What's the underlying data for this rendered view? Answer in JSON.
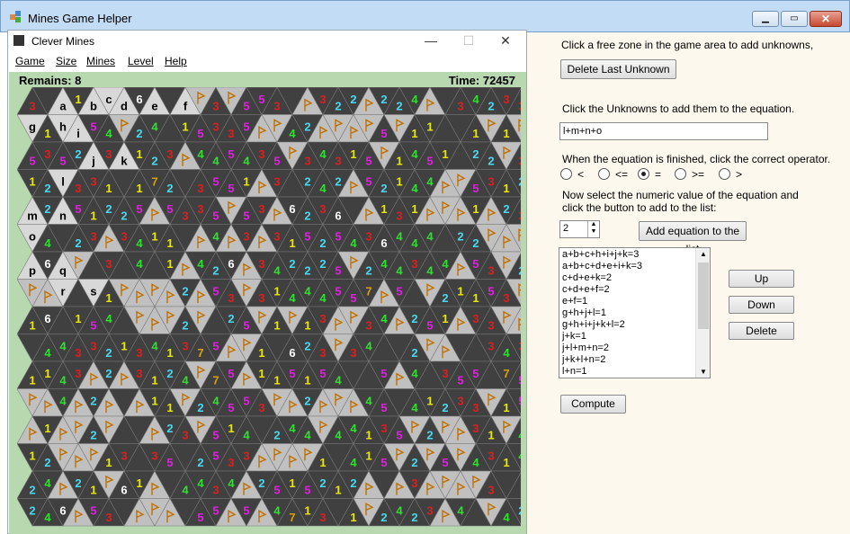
{
  "app": {
    "title": "Mines Game Helper"
  },
  "game_window": {
    "title": "Clever Mines",
    "menu": [
      "Game",
      "Size",
      "Mines",
      "Level",
      "Help"
    ],
    "remains_label": "Remains: 8",
    "time_label": "Time: 72457"
  },
  "helper": {
    "instruction_1": "Click a free zone in the game area to add unknowns,",
    "delete_last_label": "Delete Last Unknown",
    "instruction_2": "Click the Unknowns to add them to the equation.",
    "equation_value": "l+m+n+o",
    "instruction_3": "When the equation is finished, click the correct operator.",
    "operators": [
      {
        "label": "<",
        "checked": false
      },
      {
        "label": "<=",
        "checked": false
      },
      {
        "label": "=",
        "checked": true
      },
      {
        "label": ">=",
        "checked": false
      },
      {
        "label": ">",
        "checked": false
      }
    ],
    "instruction_4": "Now select the numeric value of the equation and click the button to add to the list:",
    "numeric_value": "2",
    "add_button_label": "Add equation to the list",
    "equations": [
      "a+b+c+h+i+j+k=3",
      "a+b+c+d+e+i+k=3",
      "c+d+e+k=2",
      "c+d+e+f=2",
      "e+f=1",
      "g+h+j+l=1",
      "g+h+i+j+k+l=2",
      "j+k=1",
      "j+l+m+n=2",
      "j+k+l+n=2",
      "l+n=1"
    ],
    "up_label": "Up",
    "down_label": "Down",
    "delete_label": "Delete",
    "compute_label": "Compute"
  },
  "board": {
    "unknown_labels": [
      "a",
      "b",
      "c",
      "d",
      "e",
      "f",
      "g",
      "h",
      "i",
      "j",
      "k",
      "l",
      "m",
      "n",
      "o",
      "p",
      "q",
      "r",
      "s"
    ],
    "colors": {
      "dark_cell": "#404040",
      "light_cell": "#c0c0c0",
      "white_cell": "#d8d8d8",
      "one": "#e8e800",
      "two": "#4ad8f0",
      "three": "#d82020",
      "four": "#30e030",
      "five": "#e020e0",
      "six": "#ffffff",
      "seven": "#d8a000",
      "flag": "#c07000"
    }
  }
}
